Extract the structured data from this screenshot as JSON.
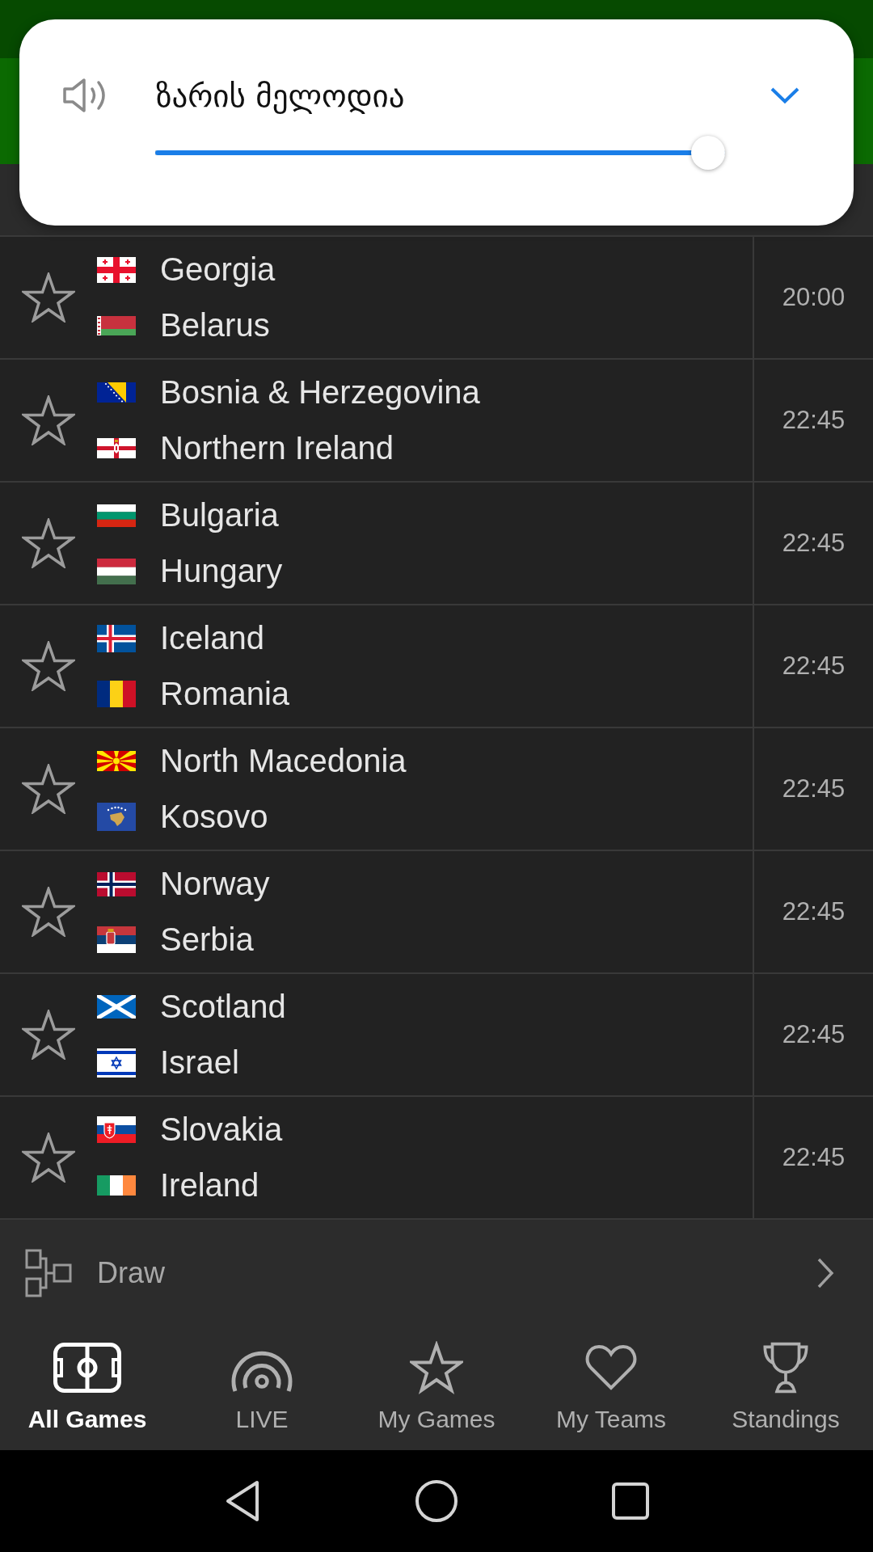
{
  "volume_popup": {
    "title": "ზარის მელოდია",
    "level": 1
  },
  "matches": [
    {
      "favorite": false,
      "teams": [
        {
          "name": "Georgia"
        },
        {
          "name": "Belarus"
        }
      ],
      "time": "20:00"
    },
    {
      "favorite": false,
      "teams": [
        {
          "name": "Bosnia & Herzegovina"
        },
        {
          "name": "Northern Ireland"
        }
      ],
      "time": "22:45"
    },
    {
      "favorite": false,
      "teams": [
        {
          "name": "Bulgaria"
        },
        {
          "name": "Hungary"
        }
      ],
      "time": "22:45"
    },
    {
      "favorite": false,
      "teams": [
        {
          "name": "Iceland"
        },
        {
          "name": "Romania"
        }
      ],
      "time": "22:45"
    },
    {
      "favorite": false,
      "teams": [
        {
          "name": "North Macedonia"
        },
        {
          "name": "Kosovo"
        }
      ],
      "time": "22:45"
    },
    {
      "favorite": false,
      "teams": [
        {
          "name": "Norway"
        },
        {
          "name": "Serbia"
        }
      ],
      "time": "22:45"
    },
    {
      "favorite": false,
      "teams": [
        {
          "name": "Scotland"
        },
        {
          "name": "Israel"
        }
      ],
      "time": "22:45"
    },
    {
      "favorite": false,
      "teams": [
        {
          "name": "Slovakia"
        },
        {
          "name": "Ireland"
        }
      ],
      "time": "22:45"
    }
  ],
  "draw_row": {
    "label": "Draw"
  },
  "bottom_nav": [
    {
      "label": "All Games",
      "selected": true
    },
    {
      "label": "LIVE",
      "selected": false
    },
    {
      "label": "My Games",
      "selected": false
    },
    {
      "label": "My Teams",
      "selected": false
    },
    {
      "label": "Standings",
      "selected": false
    }
  ]
}
